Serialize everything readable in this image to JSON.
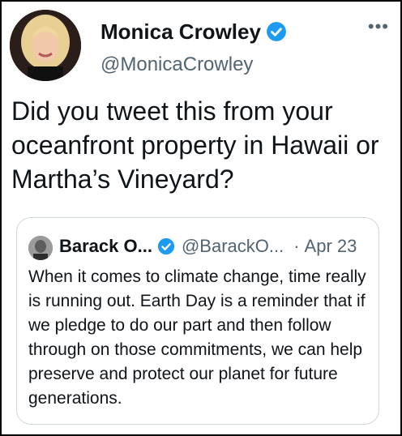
{
  "tweet": {
    "author_name": "Monica Crowley",
    "author_handle": "@MonicaCrowley",
    "more_icon": "more-horizontal-icon",
    "text": "Did you tweet this from your oceanfront property in Hawaii or Martha’s Vineyard?"
  },
  "quoted_tweet": {
    "author_name": "Barack O...",
    "author_handle": "@BarackO...",
    "separator": "·",
    "date": "Apr 23",
    "text": "When it comes to climate change, time really is running out. Earth Day is a reminder that if we pledge to do our part and then follow through on those commitments, we can help preserve and protect our planet for future generations."
  },
  "colors": {
    "verified_blue": "#1d9bf0",
    "secondary_text": "#536471",
    "primary_text": "#0f1419",
    "quote_border": "#cfd9de"
  }
}
